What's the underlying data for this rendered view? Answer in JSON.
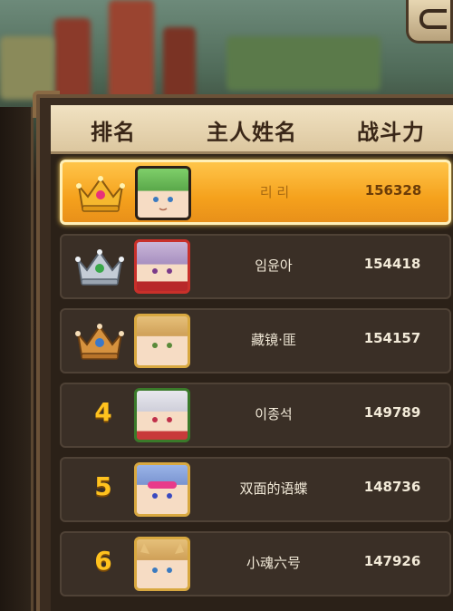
{
  "header": {
    "rank_label": "排名",
    "name_label": "主人姓名",
    "power_label": "战斗力"
  },
  "rankings": [
    {
      "rank": "1",
      "badge": "gold-crown-icon",
      "avatar": "green-hair-avatar",
      "name": "리 리",
      "power": "156328",
      "highlighted": true
    },
    {
      "rank": "2",
      "badge": "silver-crown-icon",
      "avatar": "lavender-hair-avatar",
      "name": "임윤아",
      "power": "154418",
      "highlighted": false
    },
    {
      "rank": "3",
      "badge": "bronze-crown-icon",
      "avatar": "blonde-hair-avatar",
      "name": "藏镜·匪",
      "power": "154157",
      "highlighted": false
    },
    {
      "rank": "4",
      "badge": "",
      "avatar": "white-hair-avatar",
      "name": "이종석",
      "power": "149789",
      "highlighted": false
    },
    {
      "rank": "5",
      "badge": "",
      "avatar": "blue-hair-goggles-avatar",
      "name": "双面的语蝶",
      "power": "148736",
      "highlighted": false
    },
    {
      "rank": "6",
      "badge": "",
      "avatar": "blonde-cat-ear-avatar",
      "name": "小魂六号",
      "power": "147926",
      "highlighted": false
    }
  ],
  "colors": {
    "gold": "#f5b82e",
    "silver": "#b9c2cc",
    "bronze": "#c98a3c",
    "highlight_row": "#f5a11c",
    "rank_number": "#ffc21e"
  }
}
